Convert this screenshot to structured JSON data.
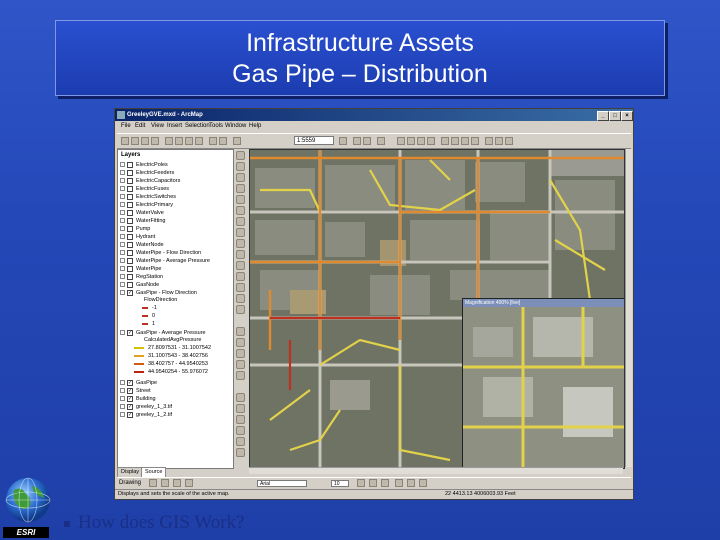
{
  "slide": {
    "title_line1": "Infrastructure Assets",
    "title_line2": "Gas Pipe – Distribution",
    "footer_text": "How does GIS Work?",
    "logo_text": "ESRI"
  },
  "window": {
    "title": "GreeleyGVE.mxd - ArcMap",
    "menu": [
      "File",
      "Edit",
      "View",
      "Insert",
      "Selection",
      "Tools",
      "Window",
      "Help"
    ],
    "scale": "1:5559",
    "toc_header": "Layers",
    "layers": [
      {
        "label": "ElectricPoles",
        "checked": false
      },
      {
        "label": "ElectricFeeders",
        "checked": false
      },
      {
        "label": "ElectricCapacitors",
        "checked": false
      },
      {
        "label": "ElectricFuses",
        "checked": false
      },
      {
        "label": "ElectricSwitches",
        "checked": false
      },
      {
        "label": "ElectricPrimary",
        "checked": false
      },
      {
        "label": "WaterValve",
        "checked": false
      },
      {
        "label": "WaterFitting",
        "checked": false
      },
      {
        "label": "Pump",
        "checked": false
      },
      {
        "label": "Hydrant",
        "checked": false
      },
      {
        "label": "WaterNode",
        "checked": false
      },
      {
        "label": "WaterPipe - Flow Direction",
        "checked": false
      },
      {
        "label": "WaterPipe - Average Pressure",
        "checked": false
      },
      {
        "label": "WaterPipe",
        "checked": false
      },
      {
        "label": "RegStation",
        "checked": false
      },
      {
        "label": "GasNode",
        "checked": false
      },
      {
        "label": "GasPipe - Flow Direction",
        "checked": true
      }
    ],
    "flow_header": "FlowDirection",
    "flow_values": [
      "-1",
      "0",
      "1"
    ],
    "pressure_layer": "GasPipe - Average Pressure",
    "pressure_field": "CalculatedAvgPressure",
    "pressure_classes": [
      {
        "label": "27.8097531 - 31.1007542",
        "color": "#d4c200"
      },
      {
        "label": "31.1007543 - 38.402756",
        "color": "#e6a020"
      },
      {
        "label": "38.402757 - 44.9540253",
        "color": "#d45a10"
      },
      {
        "label": "44.9540254 - 55.976072",
        "color": "#c02010"
      }
    ],
    "lower_layers": [
      {
        "label": "GasPipe",
        "checked": true
      },
      {
        "label": "Street",
        "checked": true
      },
      {
        "label": "Building",
        "checked": true
      },
      {
        "label": "greeley_1_3.tif",
        "checked": true
      },
      {
        "label": "greeley_1_2.tif",
        "checked": true
      }
    ],
    "tabs": [
      "Display",
      "Source"
    ],
    "magnifier_title": "Magnification 400% [live]",
    "draw_label": "Drawing",
    "font_name": "Arial",
    "font_size": "10",
    "status_text": "Displays and sets the scale of the active map.",
    "coords": "22 4413.13 4006003.93 Feet"
  }
}
